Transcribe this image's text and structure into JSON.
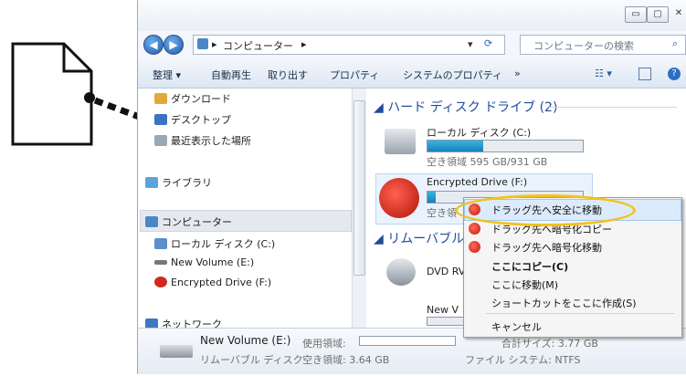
{
  "address": {
    "path_root": "▸",
    "path_label": "コンピューター",
    "path_sep": "▸"
  },
  "search": {
    "placeholder": "コンピューターの検索"
  },
  "toolbar": {
    "organize": "整理 ▾",
    "autoplay": "自動再生",
    "eject": "取り出す",
    "properties": "プロパティ",
    "system_properties": "システムのプロパティ",
    "more": "»"
  },
  "sidebar": {
    "items": [
      {
        "label": "ダウンロード"
      },
      {
        "label": "デスクトップ"
      },
      {
        "label": "最近表示した場所"
      },
      {
        "label": "ライブラリ"
      },
      {
        "label": "コンピューター"
      },
      {
        "label": "ローカル ディスク (C:)"
      },
      {
        "label": "New Volume (E:)"
      },
      {
        "label": "Encrypted Drive (F:)"
      },
      {
        "label": "ネットワーク"
      }
    ]
  },
  "main": {
    "hdd_group": "ハード ディスク ドライブ (2)",
    "removable_group": "リムーバブル",
    "drives": [
      {
        "name": "ローカル ディスク (C:)",
        "free": "空き領域 595 GB/931 GB",
        "used_fraction": 0.36
      },
      {
        "name": "Encrypted Drive (F:)",
        "free": "空き領",
        "used_fraction": 0.05
      },
      {
        "name": "DVD RV",
        "free": ""
      },
      {
        "name": "New V",
        "free": ""
      }
    ]
  },
  "context_menu": {
    "items": [
      {
        "label": "ドラッグ先へ安全に移動"
      },
      {
        "label": "ドラッグ先へ暗号化コピー"
      },
      {
        "label": "ドラッグ先へ暗号化移動"
      },
      {
        "label": "ここにコピー(C)"
      },
      {
        "label": "ここに移動(M)"
      },
      {
        "label": "ショートカットをここに作成(S)"
      },
      {
        "label": "キャンセル"
      }
    ],
    "ring_color": "#f2c21b"
  },
  "details": {
    "name": "New Volume (E:)",
    "used_label": "使用領域:",
    "type": "リムーバブル ディスク",
    "free_label": "空き領域: 3.64 GB",
    "total": "合計サイズ: 3.77 GB",
    "fs": "ファイル システム: NTFS"
  },
  "icons": [
    "document-icon",
    "back-icon",
    "forward-icon",
    "refresh-icon",
    "search-icon",
    "context-menu-app-icon"
  ]
}
